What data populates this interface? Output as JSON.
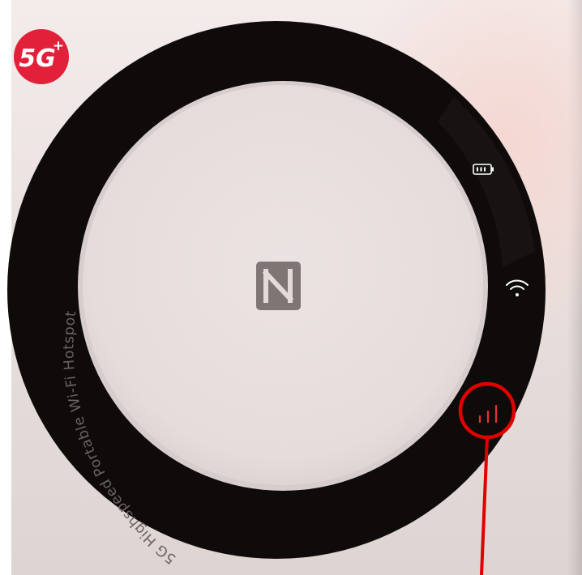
{
  "brand_badge": {
    "text": "5G+",
    "color": "#e3203a"
  },
  "ring_text": "5G Highspeed Portable Wi-Fi Hotspot",
  "center_logo": "nfc-icon",
  "status_icons": [
    {
      "name": "battery-icon",
      "color": "#ffffff"
    },
    {
      "name": "wifi-icon",
      "color": "#ffffff"
    },
    {
      "name": "signal-icon",
      "color": "#e8302f"
    }
  ],
  "highlight": {
    "target": "signal-icon",
    "color": "#e00000"
  }
}
